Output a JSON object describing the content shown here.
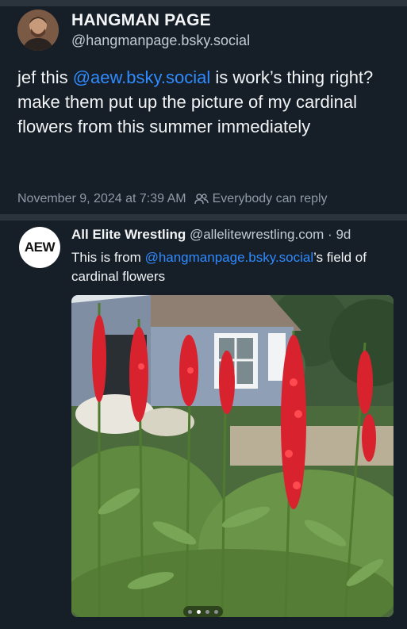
{
  "post1": {
    "author_name": "HANGMAN PAGE",
    "author_handle": "@hangmanpage.bsky.social",
    "text_before": "jef this ",
    "mention": "@aew.bsky.social",
    "text_after": " is work’s thing right?  make them put up the picture of my cardinal flowers from this summer immediately",
    "timestamp": "November 9, 2024 at 7:39 AM",
    "reply_setting": "Everybody can reply",
    "reply_icon": "people-icon"
  },
  "post2": {
    "avatar_text": "AEW",
    "author_name": "All Elite Wrestling",
    "author_handle": "@allelitewrestling.com",
    "separator": " · ",
    "age": "9d",
    "text_before": "This is from ",
    "mention": "@hangmanpage.bsky.social",
    "text_after": "’s field of cardinal flowers",
    "carousel": {
      "count": 4,
      "active_index": 1
    }
  },
  "colors": {
    "background": "#161e27",
    "divider": "#2b333d",
    "mention": "#2f8bff",
    "meta": "#8f9ba8"
  }
}
